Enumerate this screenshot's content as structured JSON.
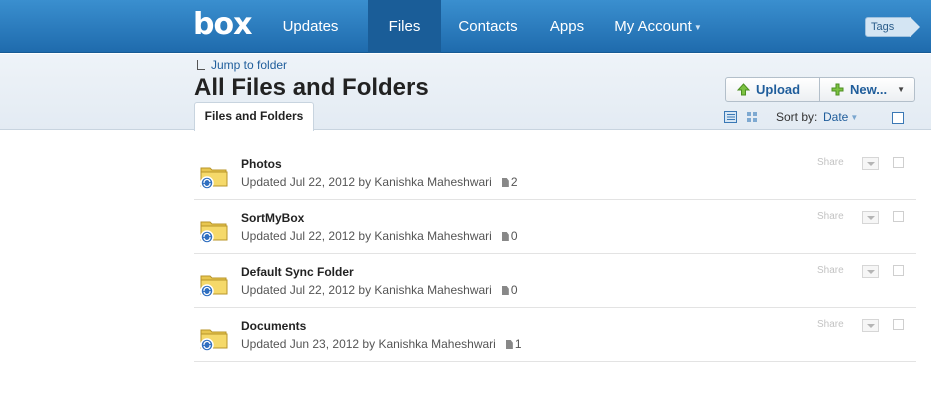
{
  "nav": {
    "logo": "box",
    "items": [
      {
        "label": "Updates"
      },
      {
        "label": "Files"
      },
      {
        "label": "Contacts"
      },
      {
        "label": "Apps"
      },
      {
        "label": "My Account"
      }
    ],
    "active": "Files",
    "tags_label": "Tags"
  },
  "header": {
    "jump_label": "Jump to folder",
    "title": "All Files and Folders",
    "tab_label": "Files and Folders",
    "upload_label": "Upload",
    "new_label": "New...",
    "sort_label": "Sort by:",
    "sort_value": "Date"
  },
  "files": [
    {
      "name": "Photos",
      "updated": "Updated Jul 22, 2012 by Kanishka Maheshwari",
      "count": "2",
      "share": "Share"
    },
    {
      "name": "SortMyBox",
      "updated": "Updated Jul 22, 2012 by Kanishka Maheshwari",
      "count": "0",
      "share": "Share"
    },
    {
      "name": "Default Sync Folder",
      "updated": "Updated Jul 22, 2012 by Kanishka Maheshwari",
      "count": "0",
      "share": "Share"
    },
    {
      "name": "Documents",
      "updated": "Updated Jun 23, 2012 by Kanishka Maheshwari",
      "count": "1",
      "share": "Share"
    }
  ],
  "colors": {
    "nav_bg": "#2a7cc0",
    "nav_active": "#1a5d98",
    "link": "#1f5d9b",
    "band_bg": "#e9eff5"
  },
  "icons": {
    "upload": "green-up-arrow-icon",
    "new": "green-plus-icon",
    "folder": "sync-folder-icon",
    "file_count": "document-icon"
  }
}
